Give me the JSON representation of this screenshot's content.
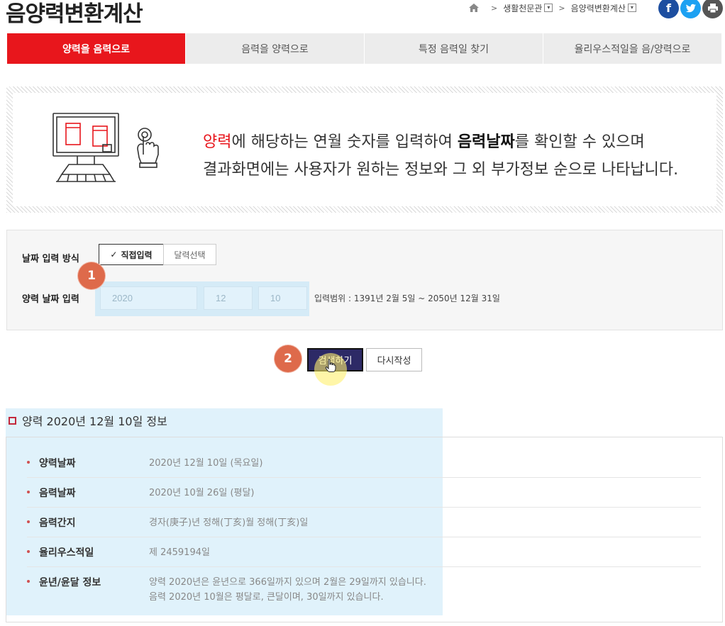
{
  "page": {
    "title": "음양력변환계산"
  },
  "breadcrumb": {
    "level1": "생활천문관",
    "level2": "음양력변환계산"
  },
  "social": {
    "facebook": "f",
    "twitter": "t",
    "print": "print"
  },
  "tabs": [
    {
      "label": "양력을 음력으로",
      "active": true
    },
    {
      "label": "음력을 양력으로",
      "active": false
    },
    {
      "label": "특정 음력일 찾기",
      "active": false
    },
    {
      "label": "율리우스적일을 음/양력으로",
      "active": false
    }
  ],
  "intro": {
    "red_word": "양력",
    "line1_a": "에 해당하는 연월 숫자를 입력하여 ",
    "line1_bold": "음력날짜",
    "line1_b": "를 확인할 수 있으며",
    "line2": "결과화면에는 사용자가 원하는 정보와 그 외 부가정보 순으로 나타납니다."
  },
  "form": {
    "mode_label": "날짜 입력 방식",
    "mode_direct": "직접입력",
    "mode_calendar": "달력선택",
    "date_label": "양력 날짜 입력",
    "year": "2020",
    "month": "12",
    "day": "10",
    "range": "입력범위 : 1391년 2월 5일 ~ 2050년 12월 31일"
  },
  "markers": {
    "one": "1",
    "two": "2"
  },
  "buttons": {
    "search": "검색하기",
    "reset": "다시작성"
  },
  "result": {
    "title": "양력 2020년 12월 10일 정보",
    "rows": [
      {
        "key": "양력날짜",
        "value": "2020년 12월 10일 (목요일)"
      },
      {
        "key": "음력날짜",
        "value": "2020년 10월 26일 (평달)"
      },
      {
        "key": "음력간지",
        "value": "경자(庚子)년 정해(丁亥)월 정해(丁亥)일"
      },
      {
        "key": "율리우스적일",
        "value": "제 2459194일"
      },
      {
        "key": "윤년/윤달 정보",
        "value": "양력 2020년은 윤년으로 366일까지 있으며 2월은 29일까지 있습니다.",
        "value2": "음력 2020년 10월은 평달로, 큰달이며, 30일까지 있습니다."
      }
    ]
  },
  "colors": {
    "accent": "#e8161c",
    "search_btn": "#2d2a66",
    "marker": "#de6a4b",
    "highlight": "#bae2f7"
  }
}
